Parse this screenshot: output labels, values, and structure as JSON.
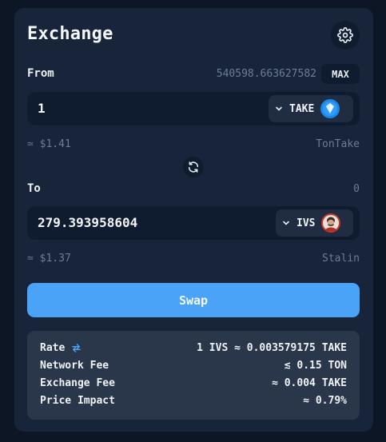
{
  "header": {
    "title": "Exchange"
  },
  "from": {
    "label": "From",
    "balance": "540598.663627582",
    "max_label": "MAX",
    "amount": "1",
    "token_symbol": "TAKE",
    "usd_value": "≃ $1.41",
    "token_name": "TonTake"
  },
  "to": {
    "label": "To",
    "balance": "0",
    "amount": "279.393958604",
    "token_symbol": "IVS",
    "usd_value": "≃ $1.37",
    "token_name": "Stalin"
  },
  "swap_button": {
    "label": "Swap"
  },
  "details": {
    "rate_label": "Rate",
    "rate_value": "1 IVS ≈ 0.003579175 TAKE",
    "network_fee_label": "Network Fee",
    "network_fee_value": "≲ 0.15 TON",
    "exchange_fee_label": "Exchange Fee",
    "exchange_fee_value": "≈ 0.004 TAKE",
    "price_impact_label": "Price Impact",
    "price_impact_value": "≈ 0.79%"
  },
  "colors": {
    "accent": "#4aa3f7",
    "background": "#0c1624",
    "card": "#17243a",
    "field": "#0f1c30"
  },
  "icons": [
    "gear-icon",
    "chevron-down-icon",
    "take-token-icon",
    "ivs-token-icon",
    "swap-direction-icon",
    "rate-swap-icon"
  ]
}
